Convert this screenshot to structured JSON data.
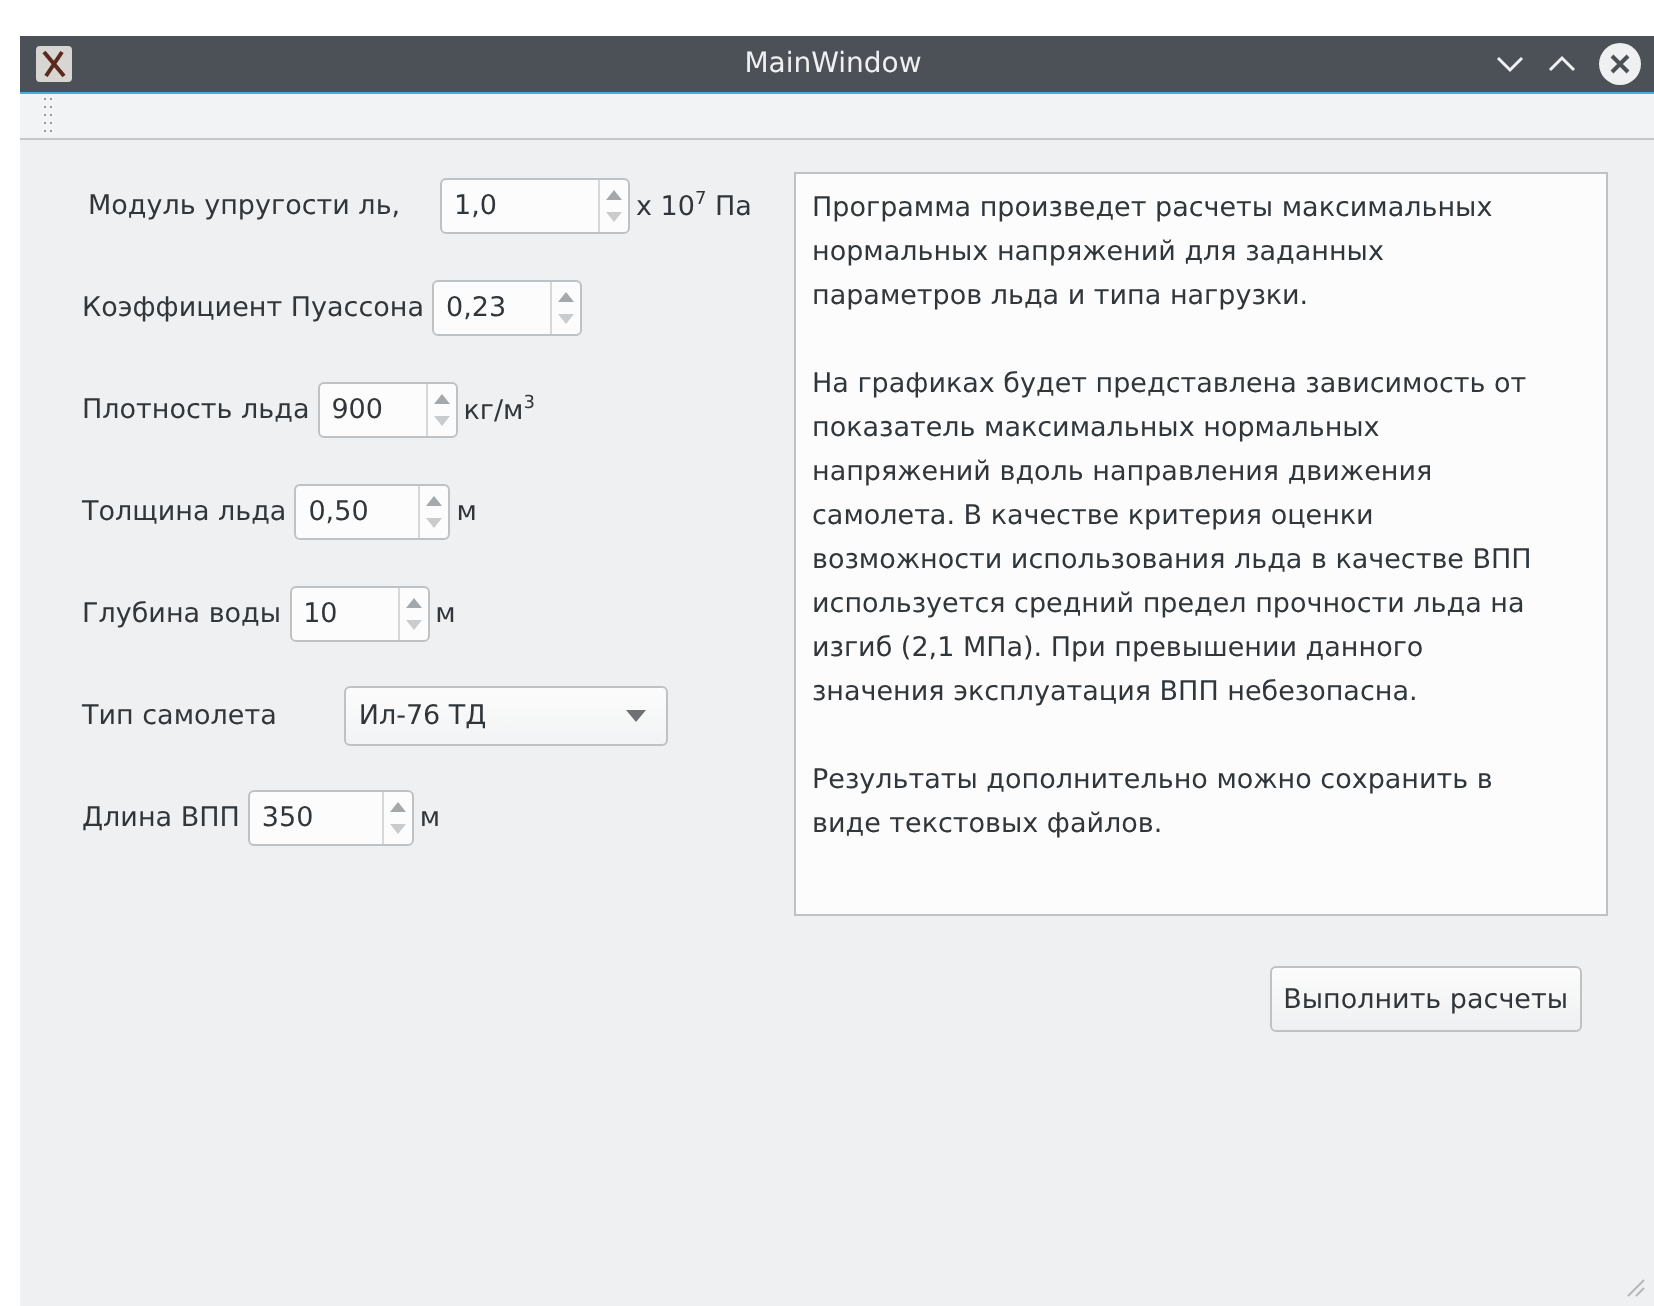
{
  "window": {
    "title": "MainWindow"
  },
  "fields": [
    {
      "kind": "spin",
      "label": "Модуль упругости ль,",
      "value": "1,0",
      "unit": "x 10$^{7}$ Па"
    },
    {
      "kind": "spin",
      "label": "Коэффициент Пуассона",
      "value": "0,23"
    },
    {
      "kind": "spin",
      "label": "Плотность льда",
      "value": "900",
      "unit": "кг/м$^{3}$"
    },
    {
      "kind": "spin",
      "label": "Толщина льда",
      "value": "0,50",
      "unit": "м"
    },
    {
      "kind": "spin",
      "label": "Глубина воды",
      "value": "10",
      "unit": "м"
    },
    {
      "kind": "combo",
      "label": "Тип самолета",
      "value": "Ил-76 ТД"
    },
    {
      "kind": "spin",
      "label": "Длина ВПП",
      "value": "350",
      "unit": "м"
    }
  ],
  "description": [
    [
      "Программа произведет расчеты максимальных",
      "нормальных напряжений для заданных",
      "параметров льда и типа нагрузки."
    ],
    [
      "На графиках будет представлена зависимость от",
      "показатель максимальных нормальных",
      "напряжений вдоль направления движения",
      "самолета. В качестве критерия оценки",
      "возможности использования льда в качестве ВПП",
      "используется средний предел прочности льда на",
      "изгиб (2,1 МПа). При превышении данного",
      "значения эксплуатация ВПП небезопасна."
    ],
    [
      "Результаты дополнительно можно сохранить в",
      "виде текстовых файлов."
    ]
  ],
  "run_button": "Выполнить расчеты"
}
